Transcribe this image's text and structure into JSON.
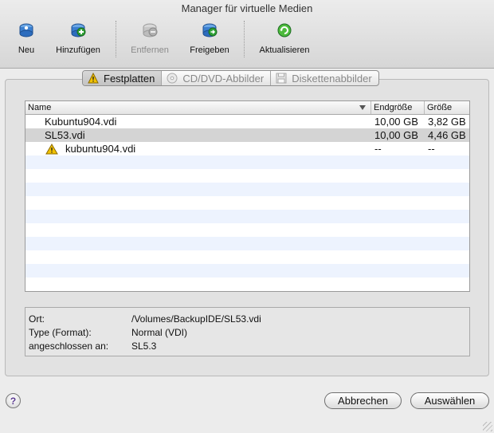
{
  "window": {
    "title": "Manager für virtuelle Medien"
  },
  "toolbar": {
    "items": [
      {
        "label": "Neu",
        "icon": "new-disk-icon",
        "enabled": true
      },
      {
        "label": "Hinzufügen",
        "icon": "add-disk-icon",
        "enabled": true
      },
      {
        "label": "Entfernen",
        "icon": "remove-disk-icon",
        "enabled": false
      },
      {
        "label": "Freigeben",
        "icon": "release-disk-icon",
        "enabled": true
      },
      {
        "label": "Aktualisieren",
        "icon": "refresh-icon",
        "enabled": true
      }
    ]
  },
  "tabs": [
    {
      "label": "Festplatten",
      "icon": "hard-disk-warning-icon",
      "active": true
    },
    {
      "label": "CD/DVD-Abbilder",
      "icon": "cd-dvd-icon",
      "active": false
    },
    {
      "label": "Diskettenabbilder",
      "icon": "floppy-icon",
      "active": false
    }
  ],
  "table": {
    "columns": [
      "Name",
      "Endgröße",
      "Größe"
    ],
    "rows": [
      {
        "name": "Kubuntu904.vdi",
        "end_size": "10,00 GB",
        "size": "3,82 GB",
        "warning": false,
        "child": false,
        "selected": false
      },
      {
        "name": "SL53.vdi",
        "end_size": "10,00 GB",
        "size": "4,46 GB",
        "warning": false,
        "child": false,
        "selected": true
      },
      {
        "name": "kubuntu904.vdi",
        "end_size": "--",
        "size": "--",
        "warning": true,
        "child": true,
        "selected": false
      }
    ]
  },
  "info": {
    "location_label": "Ort:",
    "location_value": "/Volumes/BackupIDE/SL53.vdi",
    "type_label": "Type (Format):",
    "type_value": "Normal (VDI)",
    "attached_label": "angeschlossen an:",
    "attached_value": "SL5.3"
  },
  "buttons": {
    "help": "?",
    "cancel": "Abbrechen",
    "select": "Auswählen"
  },
  "colors": {
    "selected_row": "#d4d4d4",
    "alt_row": "#edf3fe",
    "accent_blue": "#2f6fc5",
    "accent_green": "#2fa236",
    "warning_yellow": "#f2c200"
  }
}
